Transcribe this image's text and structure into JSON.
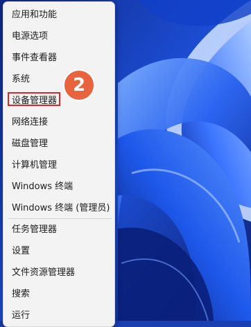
{
  "colors": {
    "menu_bg": "#f3f3f3",
    "highlight": "#d8262b",
    "badge": "#e8643e",
    "wallpaper": "#1a3fb0"
  },
  "menu": {
    "items": [
      {
        "label": "应用和功能"
      },
      {
        "label": "电源选项"
      },
      {
        "label": "事件查看器"
      },
      {
        "label": "系统"
      },
      {
        "label": "设备管理器"
      },
      {
        "label": "网络连接"
      },
      {
        "label": "磁盘管理"
      },
      {
        "label": "计算机管理"
      },
      {
        "label": "Windows 终端"
      },
      {
        "label": "Windows 终端 (管理员)"
      },
      {
        "label": "任务管理器"
      },
      {
        "label": "设置"
      },
      {
        "label": "文件资源管理器"
      },
      {
        "label": "搜索"
      },
      {
        "label": "运行"
      }
    ]
  },
  "annotation": {
    "step_number": "2",
    "highlighted_item": "设备管理器"
  }
}
